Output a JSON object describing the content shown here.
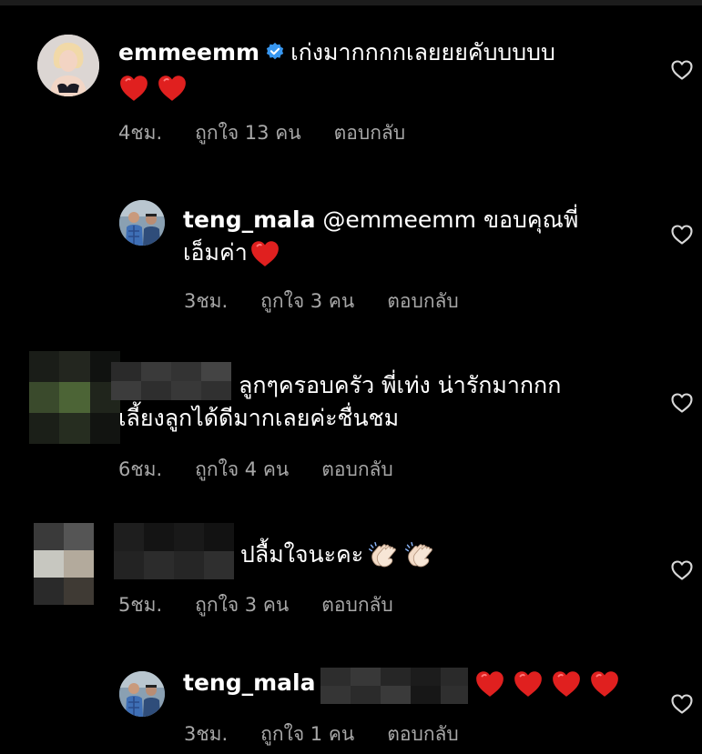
{
  "comments": [
    {
      "username": "emmeemm",
      "verified": true,
      "text": "เก่งมากกกกเลยยยคับบบบบ",
      "time": "4ชม.",
      "likes": "ถูกใจ 13 คน",
      "reply": "ตอบกลับ"
    },
    {
      "username": "teng_mala",
      "mention": "@emmeemm",
      "text_a": "ขอบคุณพี่",
      "text_b": "เอ็มค่า",
      "time": "3ชม.",
      "likes": "ถูกใจ 3 คน",
      "reply": "ตอบกลับ"
    },
    {
      "text_a": "ลูกๆครอบครัว พี่เท่ง น่ารักมากกก",
      "text_b": "เลี้ยงลูกได้ดีมากเลยค่ะชื่นชม",
      "time": "6ชม.",
      "likes": "ถูกใจ 4 คน",
      "reply": "ตอบกลับ"
    },
    {
      "text": "ปลื้มใจนะคะ",
      "time": "5ชม.",
      "likes": "ถูกใจ 3 คน",
      "reply": "ตอบกลับ"
    },
    {
      "username": "teng_mala",
      "time": "3ชม.",
      "likes": "ถูกใจ 1 คน",
      "reply": "ตอบกลับ"
    }
  ],
  "icons": {
    "like": "heart-outline-icon",
    "verified": "verified-badge-icon",
    "emoji": "red-heart-emoji",
    "clap": "clapping-hands-emoji"
  },
  "colors": {
    "background": "#000000",
    "meta_text": "#a8a8a8",
    "verified_blue": "#3897f0",
    "heart_red": "#e0201f"
  }
}
